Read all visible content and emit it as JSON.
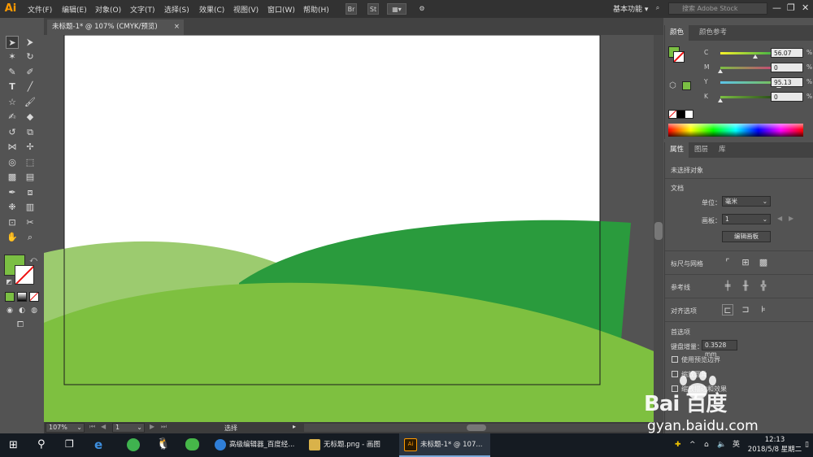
{
  "app": {
    "logo": "Ai"
  },
  "menu": [
    "文件(F)",
    "编辑(E)",
    "对象(O)",
    "文字(T)",
    "选择(S)",
    "效果(C)",
    "视图(V)",
    "窗口(W)",
    "帮助(H)"
  ],
  "toolbar_top": {
    "br_label": "Br",
    "st_label": "St"
  },
  "workspace": "基本功能 ▾",
  "search": {
    "placeholder": "搜索 Adobe Stock"
  },
  "window_controls": {
    "minimize": "—",
    "restore": "❐",
    "close": "✕"
  },
  "document_tab": {
    "title": "未标题-1* @ 107% (CMYK/预览)",
    "close": "×"
  },
  "color_panel": {
    "tabs": [
      "颜色",
      "颜色参考"
    ],
    "channels": [
      {
        "label": "C",
        "value": "56.07",
        "fraction": 0.56,
        "gradient": [
          "#f7f22a",
          "#23a84a"
        ]
      },
      {
        "label": "M",
        "value": "0",
        "fraction": 0.0,
        "gradient": [
          "#7bbf43",
          "#d4347e"
        ]
      },
      {
        "label": "Y",
        "value": "95.13",
        "fraction": 0.95,
        "gradient": [
          "#5cc3e8",
          "#7bbf43"
        ]
      },
      {
        "label": "K",
        "value": "0",
        "fraction": 0.0,
        "gradient": [
          "#7bbf43",
          "#1d3a12"
        ]
      }
    ],
    "unit": "%",
    "fill_color": "#7bbf43"
  },
  "properties_panel": {
    "tabs": [
      "属性",
      "图层",
      "库"
    ],
    "no_selection": "未选择对象",
    "document_label": "文档",
    "units_label": "单位：",
    "units_value": "毫米",
    "artboard_label": "画板：",
    "artboard_value": "1",
    "edit_artboard": "编辑画板",
    "rulers_grids": "标尺与网格",
    "guides": "参考线",
    "snap_options": "对齐选项",
    "preferences": "首选项",
    "keyboard_increment_label": "键盘增量：",
    "keyboard_increment_value": "0.3528 mm",
    "use_preview_bounds": "使用预览边界",
    "scale_corners": "缩放圆角",
    "scale_strokes": "缩放描边和效果"
  },
  "status_bar": {
    "zoom": "107%",
    "artboard": "1",
    "tool": "选择"
  },
  "taskbar": {
    "items": [
      {
        "label": "高级编辑器_百度经...",
        "color": "#2f7fd8"
      },
      {
        "label": "无标题.png - 画图",
        "color": "#d9b24a"
      },
      {
        "label": "未标题-1* @ 107...",
        "color": "#ff9a00"
      }
    ],
    "ime": "英",
    "time": "12:13",
    "date": "2018/5/8 星期二"
  },
  "artwork_colors": {
    "light_hill": "#9ccb6f",
    "dark_hill": "#2a9b3d",
    "front_hill": "#7ec040",
    "artboard": "#ffffff"
  },
  "watermark": {
    "brand": "Bai 百度",
    "site": "gyan.baidu.com"
  }
}
